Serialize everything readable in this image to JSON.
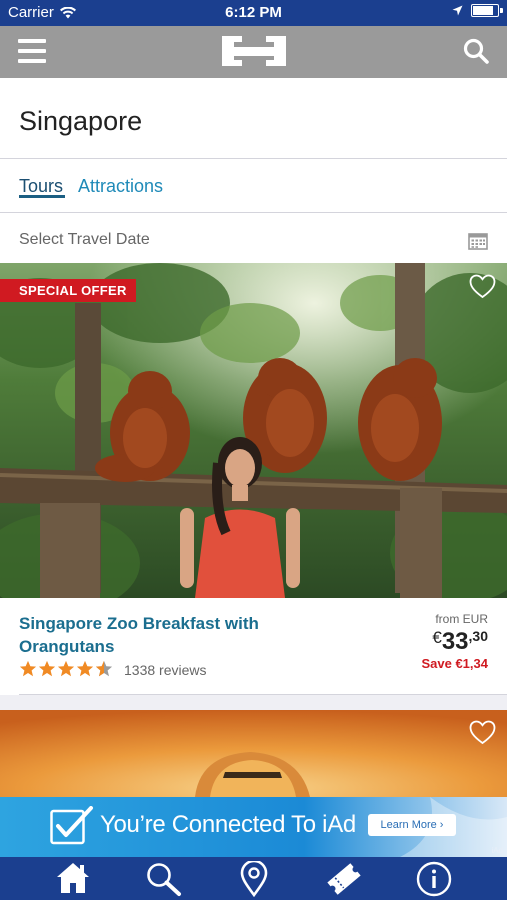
{
  "status_bar": {
    "carrier": "Carrier",
    "time": "6:12 PM"
  },
  "nav": {
    "logo_icon": "hotels-h-logo-icon",
    "menu_icon": "hamburger-menu-icon",
    "search_icon": "search-icon"
  },
  "city": {
    "title": "Singapore"
  },
  "tabs": [
    {
      "label": "Tours",
      "selected": true
    },
    {
      "label": "Attractions",
      "selected": false
    }
  ],
  "date_picker": {
    "label": "Select Travel Date",
    "icon": "calendar-icon"
  },
  "tour_card": {
    "badge": "SPECIAL OFFER",
    "title": "Singapore Zoo Breakfast with Orangutans",
    "rating": 4.5,
    "reviews": "1338 reviews",
    "from_label": "from EUR",
    "price_currency": "€",
    "price_main": "33",
    "price_cents": ",30",
    "save": "Save €1,34",
    "favorite_icon": "heart-outline-icon"
  },
  "ad_banner": {
    "text": "You’re Connected To iAd",
    "button": "Learn More ›",
    "small": "iAd"
  },
  "tab_bar": {
    "icons": [
      "home-icon",
      "search-icon",
      "location-pin-icon",
      "ticket-icon",
      "info-icon"
    ]
  },
  "colors": {
    "status_bar": "#1b3f8f",
    "nav_bar": "#9a9a9a",
    "accent_link": "#1f8ab8",
    "offer_red": "#d01a21",
    "star_orange": "#f08a24"
  }
}
